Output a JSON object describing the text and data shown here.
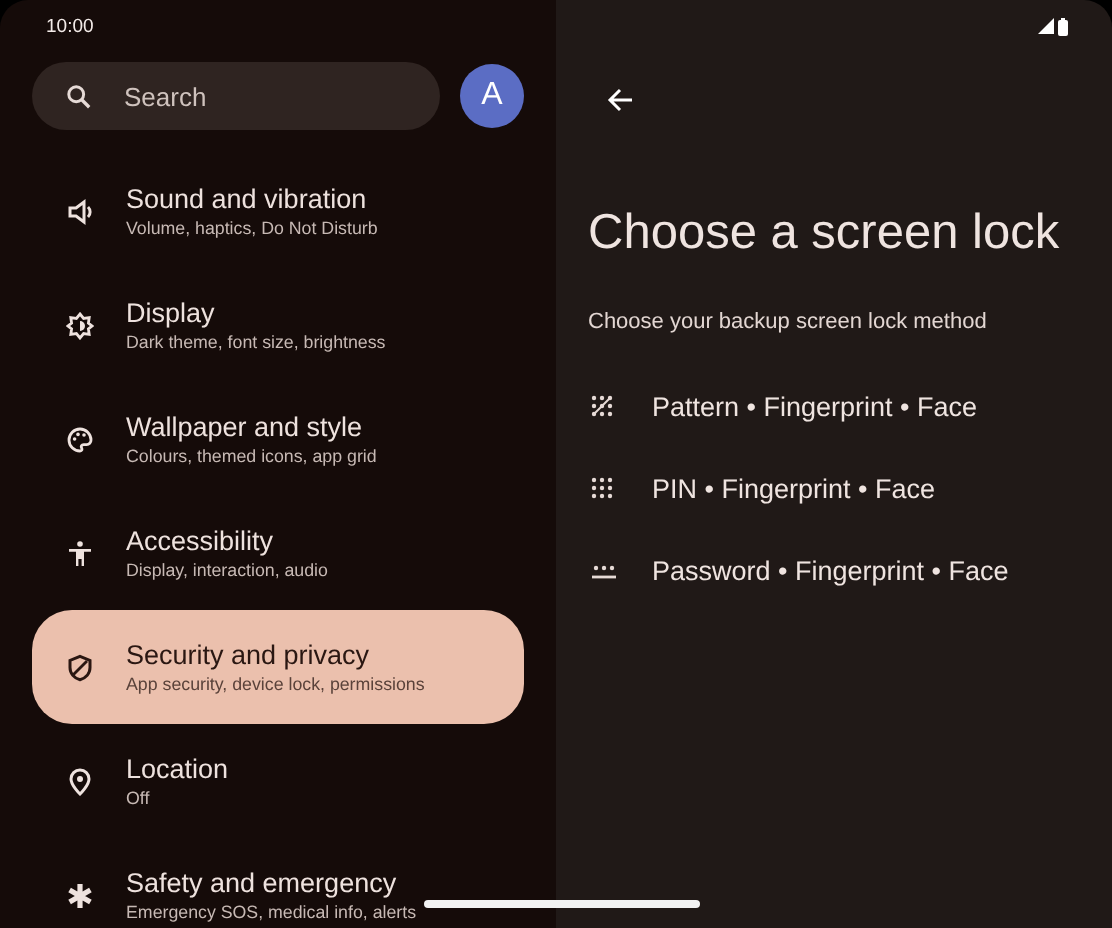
{
  "status_bar": {
    "time": "10:00"
  },
  "search": {
    "placeholder": "Search"
  },
  "account": {
    "initial": "A"
  },
  "settings": [
    {
      "title": "Sound and vibration",
      "subtitle": "Volume, haptics, Do Not Disturb",
      "selected": false
    },
    {
      "title": "Display",
      "subtitle": "Dark theme, font size, brightness",
      "selected": false
    },
    {
      "title": "Wallpaper and style",
      "subtitle": "Colours, themed icons, app grid",
      "selected": false
    },
    {
      "title": "Accessibility",
      "subtitle": "Display, interaction, audio",
      "selected": false
    },
    {
      "title": "Security and privacy",
      "subtitle": "App security, device lock, permissions",
      "selected": true
    },
    {
      "title": "Location",
      "subtitle": "Off",
      "selected": false
    },
    {
      "title": "Safety and emergency",
      "subtitle": "Emergency SOS, medical info, alerts",
      "selected": false
    }
  ],
  "detail": {
    "title": "Choose a screen lock",
    "subtitle": "Choose your backup screen lock method",
    "options": [
      {
        "kind": "pattern",
        "label": "Pattern • Fingerprint • Face"
      },
      {
        "kind": "pin",
        "label": "PIN • Fingerprint • Face"
      },
      {
        "kind": "password",
        "label": "Password • Fingerprint • Face"
      }
    ]
  }
}
